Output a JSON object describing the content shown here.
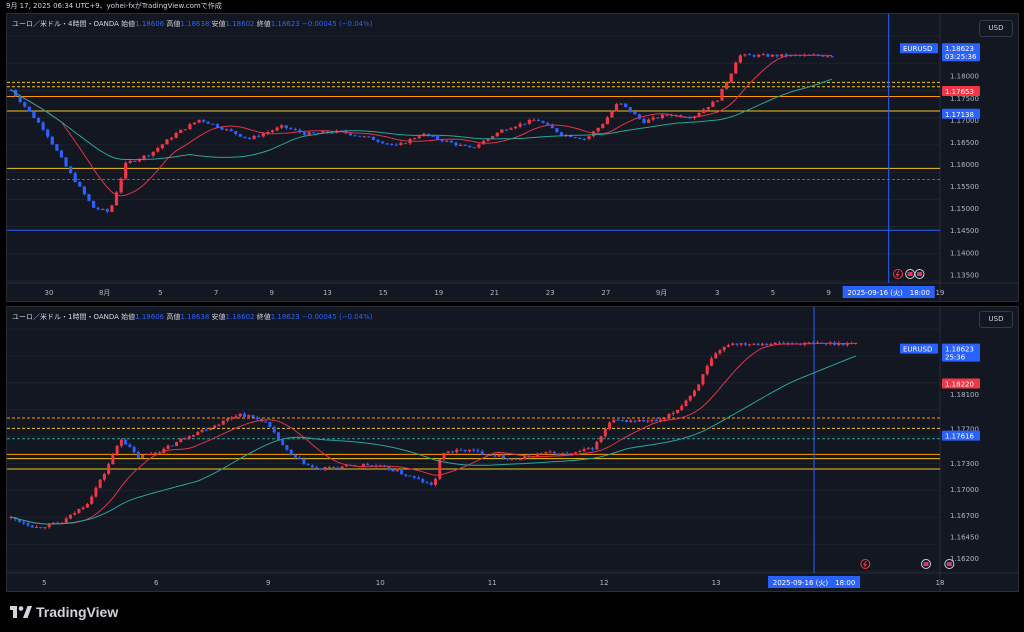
{
  "header": {
    "text": "9月 17, 2025 06:34 UTC+9、yohei-fxがTradingView.comで作成"
  },
  "colors": {
    "bg": "#131722",
    "up": "#f23645",
    "down": "#2962ff",
    "ma_red": "#e0344a",
    "ma_teal": "#26a69a",
    "level_yellow": "#f0c419",
    "level_orange": "#ff9800",
    "grid": "#1e222d",
    "cursor": "#2962ff"
  },
  "panels": [
    {
      "id": "p1",
      "legend": {
        "symbol": "ユーロ／米ドル・4時間・OANDA",
        "open_label": "始値",
        "open": "1.18606",
        "high_label": "高値",
        "high": "1.18638",
        "low_label": "安値",
        "low": "1.18602",
        "close_label": "終値",
        "close": "1.18623",
        "change": "−0.00045 (−0.04%)"
      },
      "currency_button": "USD",
      "price_ticks": [
        "1.18000",
        "1.17500",
        "1.17000",
        "1.16500",
        "1.16000",
        "1.15500",
        "1.15000",
        "1.14500",
        "1.14000",
        "1.13500"
      ],
      "time_ticks": [
        "30",
        "8月",
        "5",
        "7",
        "9",
        "13",
        "15",
        "19",
        "21",
        "23",
        "27",
        "9月",
        "3",
        "5",
        "9",
        "11",
        "19"
      ],
      "price_labels": [
        {
          "text": "EURUSD",
          "value": "1.18623",
          "sub": "03:25:36",
          "color": "#2962ff"
        },
        {
          "text": "",
          "value": "1.17653",
          "sub": "",
          "color": "#f23645"
        },
        {
          "text": "",
          "value": "1.17138",
          "sub": "",
          "color": "#2962ff"
        }
      ],
      "crosshair_time": "2025-09-16 (火)　18:00",
      "y_range": [
        1.1335,
        1.189
      ],
      "levels": [
        {
          "price": 1.1785,
          "color": "#f0c419",
          "style": "dashed"
        },
        {
          "price": 1.1775,
          "color": "#f0c419",
          "style": "dashed"
        },
        {
          "price": 1.1753,
          "color": "#ff9800",
          "style": "solid"
        },
        {
          "price": 1.172,
          "color": "#f0c419",
          "style": "solid"
        },
        {
          "price": 1.159,
          "color": "#f0c419",
          "style": "solid"
        },
        {
          "price": 1.1565,
          "color": "#2962ff",
          "style": "dashed"
        },
        {
          "price": 1.145,
          "color": "#2962ff",
          "style": "solid"
        }
      ]
    },
    {
      "id": "p2",
      "legend": {
        "symbol": "ユーロ／米ドル・1時間・OANDA",
        "open_label": "始値",
        "open": "1.18606",
        "high_label": "高値",
        "high": "1.18638",
        "low_label": "安値",
        "low": "1.18602",
        "close_label": "終値",
        "close": "1.18623",
        "change": "−0.00045 (−0.04%)"
      },
      "currency_button": "USD",
      "price_ticks": [
        "1.18100",
        "1.17700",
        "1.17300",
        "1.17000",
        "1.16700",
        "1.16450",
        "1.16200"
      ],
      "time_ticks": [
        "5",
        "6",
        "9",
        "10",
        "11",
        "12",
        "13",
        "16",
        "18"
      ],
      "price_labels": [
        {
          "text": "EURUSD",
          "value": "1.18623",
          "sub": "25:36",
          "color": "#2962ff"
        },
        {
          "text": "",
          "value": "1.18220",
          "sub": "",
          "color": "#f23645"
        },
        {
          "text": "",
          "value": "1.17616",
          "sub": "",
          "color": "#2962ff"
        }
      ],
      "crosshair_time": "2025-09-16 (火)　18:00",
      "y_range": [
        1.1605,
        1.1885
      ],
      "levels": [
        {
          "price": 1.1782,
          "color": "#ff9800",
          "style": "dashed"
        },
        {
          "price": 1.177,
          "color": "#f0c419",
          "style": "dashed"
        },
        {
          "price": 1.1758,
          "color": "#26a69a",
          "style": "dashed"
        },
        {
          "price": 1.174,
          "color": "#ff9800",
          "style": "solid"
        },
        {
          "price": 1.1735,
          "color": "#f0c419",
          "style": "solid"
        },
        {
          "price": 1.1723,
          "color": "#f0c419",
          "style": "solid"
        }
      ]
    }
  ],
  "footer": {
    "brand": "TradingView"
  }
}
